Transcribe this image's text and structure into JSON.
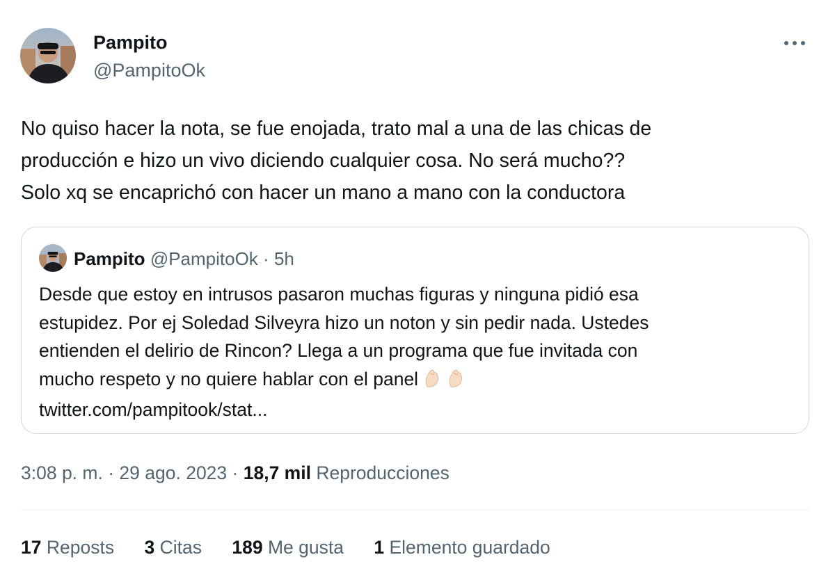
{
  "author": {
    "name": "Pampito",
    "handle": "@PampitoOk"
  },
  "tweet": {
    "text": "No quiso hacer la nota, se fue enojada, trato mal a una de las chicas de\nproducción e hizo un vivo diciendo cualquier cosa. No será mucho??\nSolo xq se encaprichó con hacer un mano a mano con la conductora"
  },
  "quoted": {
    "name": "Pampito",
    "handle": "@PampitoOk",
    "separator": "·",
    "time": "5h",
    "lines": [
      "Desde que estoy en intrusos pasaron muchas figuras y ninguna pidió esa",
      "estupidez. Por ej Soledad Silveyra hizo un noton y sin pedir nada. Ustedes",
      "entienden el delirio de Rincon? Llega a un programa que fue invitada con",
      "mucho respeto y no quiere hablar con el panel",
      "twitter.com/pampitook/stat..."
    ],
    "emoji_icons": [
      "pinched-fingers-icon",
      "pinched-fingers-icon"
    ]
  },
  "meta": {
    "time": "3:08 p. m.",
    "separator": "·",
    "date": "29 ago. 2023",
    "views_count": "18,7 mil",
    "views_label": "Reproducciones"
  },
  "stats": {
    "reposts": {
      "count": "17",
      "label": "Reposts"
    },
    "quotes": {
      "count": "3",
      "label": "Citas"
    },
    "likes": {
      "count": "189",
      "label": "Me gusta"
    },
    "bookmarks": {
      "count": "1",
      "label": "Elemento guardado"
    }
  },
  "icons": {
    "more": "more-horizontal-icon"
  },
  "colors": {
    "text_primary": "#0f1419",
    "text_secondary": "#536471",
    "border": "#cfd9de",
    "divider": "#eff3f4"
  }
}
